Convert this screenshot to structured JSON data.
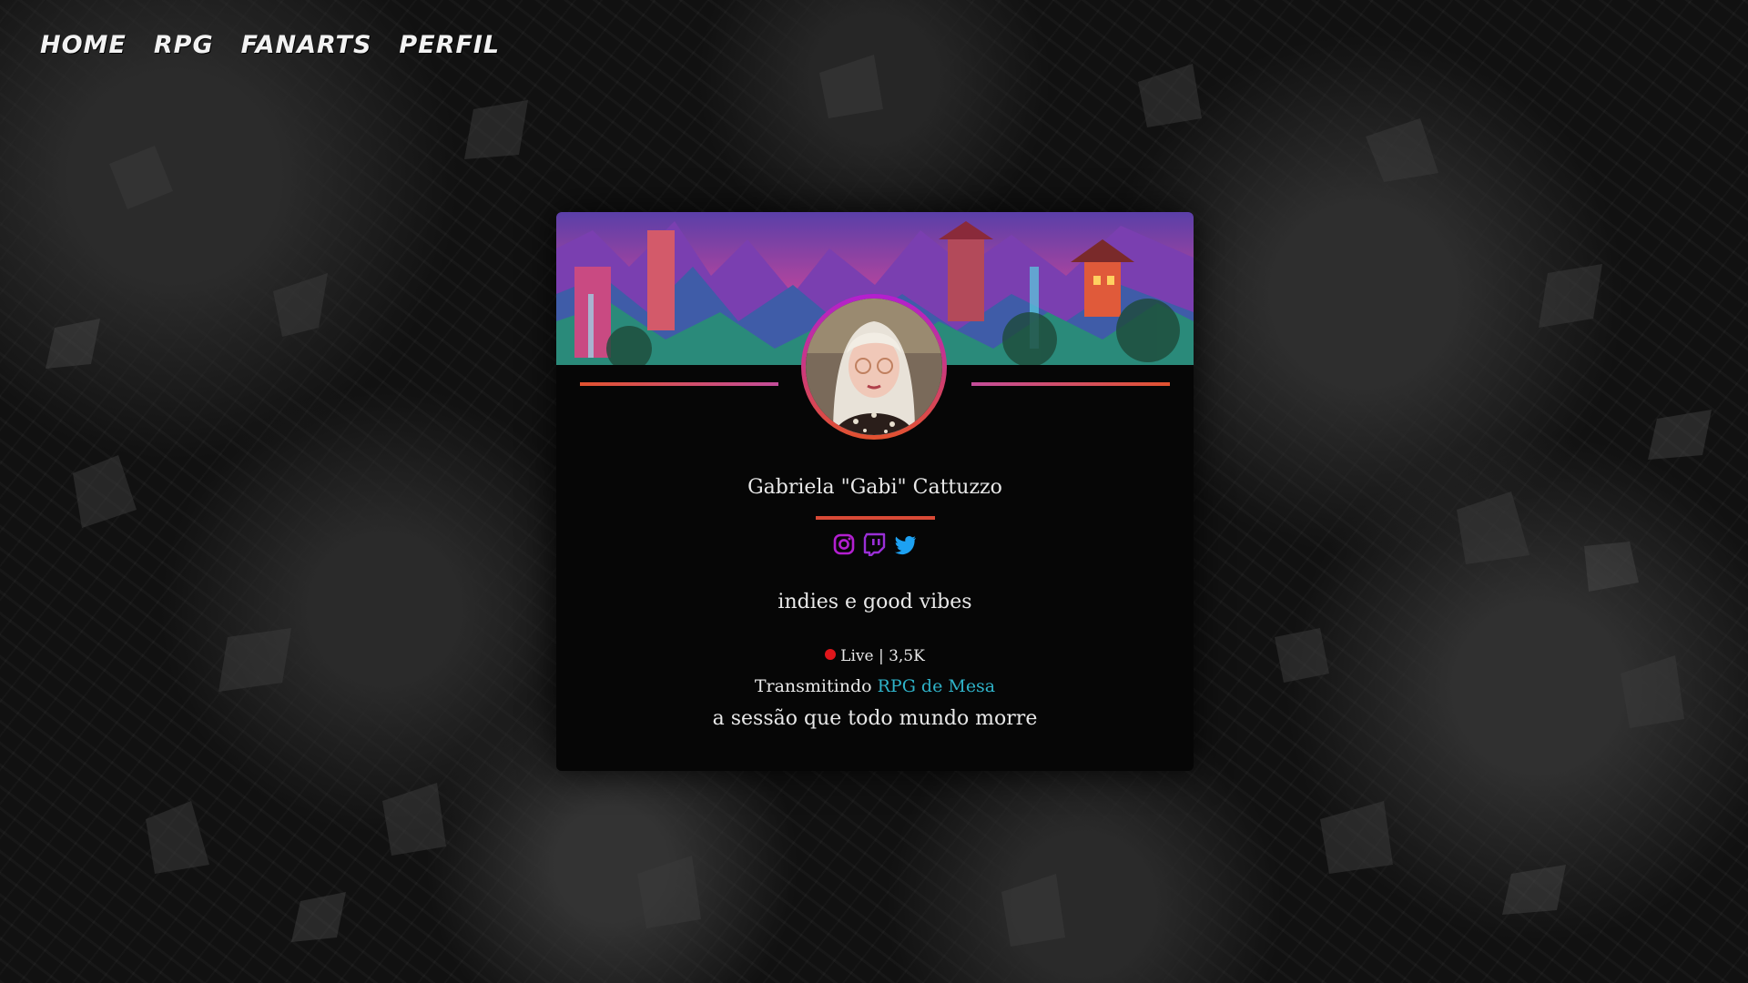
{
  "nav": {
    "items": [
      {
        "label": "HOME"
      },
      {
        "label": "RPG"
      },
      {
        "label": "FANARTS"
      },
      {
        "label": "PERFIL"
      }
    ]
  },
  "profile": {
    "name": "Gabriela \"Gabi\" Cattuzzo",
    "tagline": "indies e good vibes",
    "socials": [
      {
        "icon": "instagram-icon",
        "color": "#b31fd0"
      },
      {
        "icon": "twitch-icon",
        "color": "#9a2fd6"
      },
      {
        "icon": "twitter-icon",
        "color": "#1da1f2"
      }
    ]
  },
  "stream": {
    "live_text": "Live | 3,5K",
    "streaming_prefix": "Transmitindo",
    "game": "RPG de Mesa",
    "session_title": "a sessão que todo mundo morre"
  },
  "colors": {
    "accent_line": "#e2522f",
    "avatar_ring": "#b31fd0",
    "live_dot": "#e0161b",
    "game_link": "#2fb3c9"
  }
}
